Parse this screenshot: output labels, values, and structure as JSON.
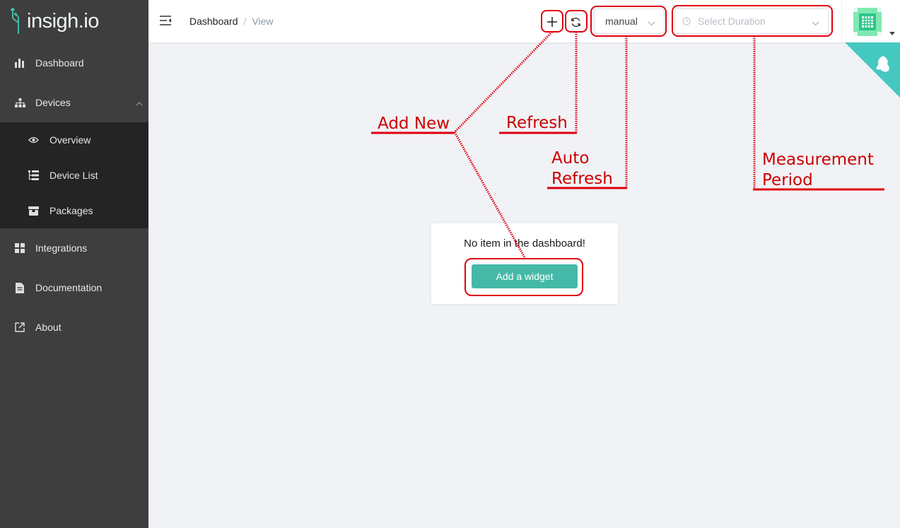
{
  "sidebar": {
    "brand": "insigh.io",
    "items": [
      {
        "label": "Dashboard",
        "icon": "bar-chart-icon"
      },
      {
        "label": "Devices",
        "icon": "sitemap-icon"
      },
      {
        "label": "Integrations",
        "icon": "grid-icon"
      },
      {
        "label": "Documentation",
        "icon": "document-icon"
      },
      {
        "label": "About",
        "icon": "external-link-icon"
      }
    ],
    "devices_submenu": [
      {
        "label": "Overview",
        "icon": "eye-icon"
      },
      {
        "label": "Device List",
        "icon": "list-icon"
      },
      {
        "label": "Packages",
        "icon": "package-icon"
      }
    ]
  },
  "header": {
    "breadcrumb": [
      "Dashboard",
      "/",
      "View"
    ],
    "refresh_mode": "manual",
    "duration_placeholder": "Select Duration"
  },
  "empty_state": {
    "message": "No item in the dashboard!",
    "button_label": "Add a widget"
  },
  "annotations": {
    "add_new": "Add New",
    "refresh": "Refresh",
    "auto_refresh_line1": "Auto",
    "auto_refresh_line2": "Refresh",
    "measurement_line1": "Measurement",
    "measurement_line2": "Period",
    "color": "#cc0000"
  },
  "colors": {
    "sidebar_bg": "#3e3e3e",
    "submenu_bg": "#242424",
    "accent": "#45b9a7",
    "avatar": "#7fe8b3"
  }
}
